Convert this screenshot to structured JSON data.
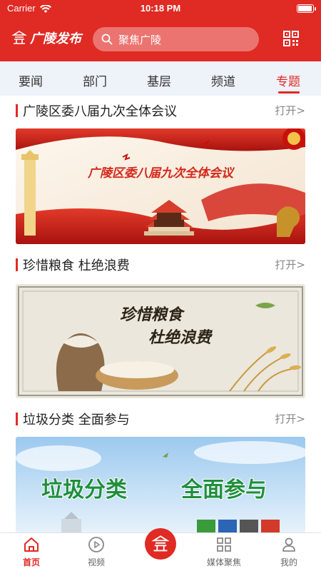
{
  "status_bar": {
    "carrier": "Carrier",
    "time": "10:18 PM"
  },
  "header": {
    "brand": "广陵发布",
    "search_placeholder": "聚焦广陵"
  },
  "tabs": [
    {
      "label": "要闻"
    },
    {
      "label": "部门"
    },
    {
      "label": "基层"
    },
    {
      "label": "频道"
    },
    {
      "label": "专题"
    }
  ],
  "active_tab": "专题",
  "sections": [
    {
      "title": "广陵区委八届九次全体会议",
      "open": "打开>",
      "banner_text": "广陵区委八届九次全体会议"
    },
    {
      "title": "珍惜粮食 杜绝浪费",
      "open": "打开>",
      "banner_line1": "珍惜粮食",
      "banner_line2": "杜绝浪费"
    },
    {
      "title": "垃圾分类 全面参与",
      "open": "打开>",
      "banner_line1": "垃圾分类",
      "banner_line2": "全面参与"
    }
  ],
  "bottom_nav": [
    {
      "label": "首页"
    },
    {
      "label": "视频"
    },
    {
      "label": "媒体聚焦"
    },
    {
      "label": "我的"
    }
  ],
  "colors": {
    "brand_red": "#e02a24",
    "tab_bg": "#eef2f9"
  }
}
